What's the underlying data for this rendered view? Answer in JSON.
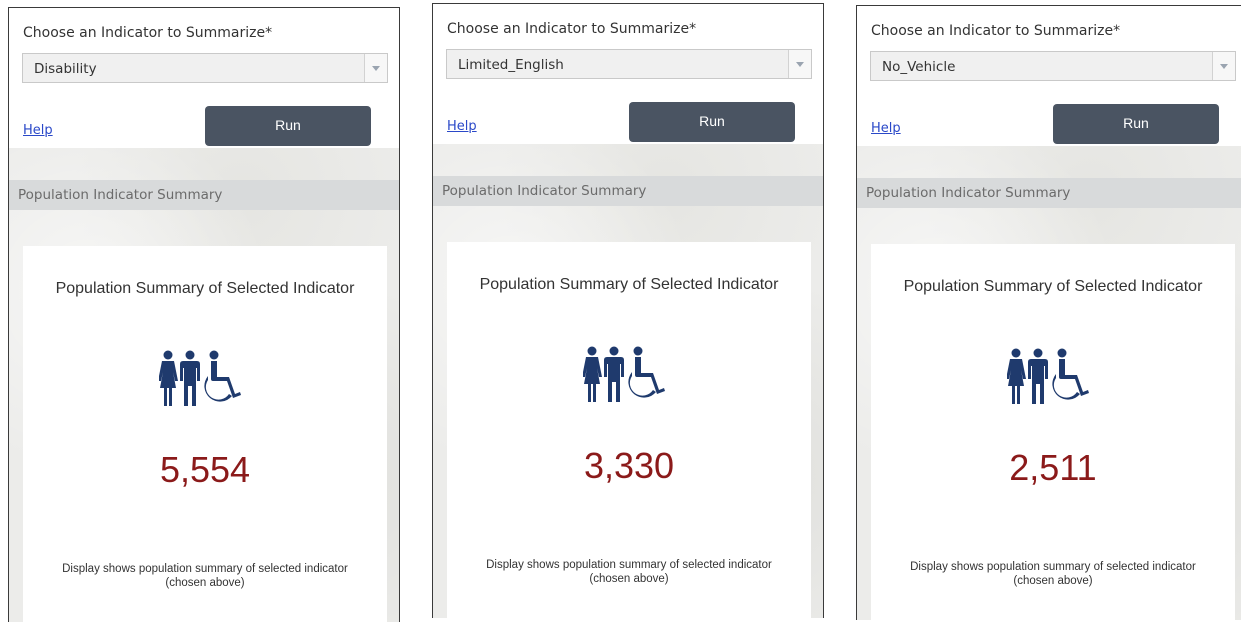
{
  "panels": [
    {
      "select_label": "Choose an Indicator to Summarize*",
      "selected_value": "Disability",
      "help_label": "Help",
      "run_label": "Run",
      "section_header": "Population Indicator Summary",
      "card_title": "Population Summary of Selected Indicator",
      "count": "5,554",
      "note_line1": "Display shows population summary of selected indicator",
      "note_line2": "(chosen above)"
    },
    {
      "select_label": "Choose an Indicator to Summarize*",
      "selected_value": "Limited_English",
      "help_label": "Help",
      "run_label": "Run",
      "section_header": "Population Indicator Summary",
      "card_title": "Population Summary of Selected Indicator",
      "count": "3,330",
      "note_line1": "Display shows population summary of selected indicator",
      "note_line2": "(chosen above)"
    },
    {
      "select_label": "Choose an Indicator to Summarize*",
      "selected_value": "No_Vehicle",
      "help_label": "Help",
      "run_label": "Run",
      "section_header": "Population Indicator Summary",
      "card_title": "Population Summary of Selected Indicator",
      "count": "2,511",
      "note_line1": "Display shows population summary of selected indicator",
      "note_line2": "(chosen above)"
    }
  ],
  "icons": {
    "dropdown": "chevron-down-icon",
    "population": "people-wheelchair-icon"
  },
  "colors": {
    "run_button": "#4a5462",
    "count_text": "#8b1a1a",
    "icon": "#1f3a6d",
    "link": "#2a48c8",
    "header_band": "#d8dadb"
  }
}
